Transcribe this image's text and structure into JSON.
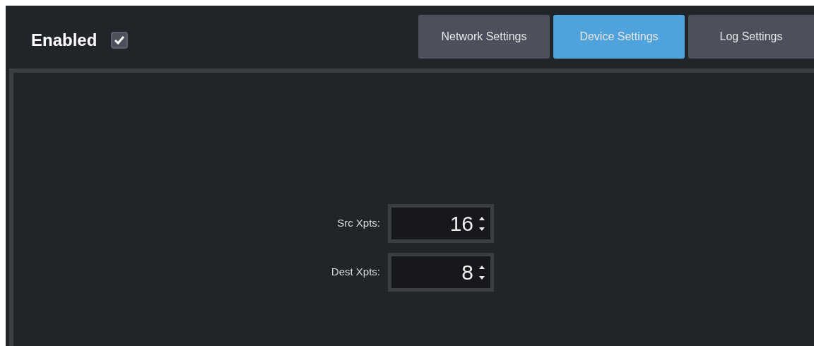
{
  "header": {
    "label": "Enabled",
    "checked": true
  },
  "tabs": [
    {
      "label": "Network Settings",
      "selected": false
    },
    {
      "label": "Device Settings",
      "selected": true
    },
    {
      "label": "Log Settings",
      "selected": false
    }
  ],
  "fields": [
    {
      "label": "Src Xpts:",
      "value": "16"
    },
    {
      "label": "Dest Xpts:",
      "value": "8"
    }
  ]
}
